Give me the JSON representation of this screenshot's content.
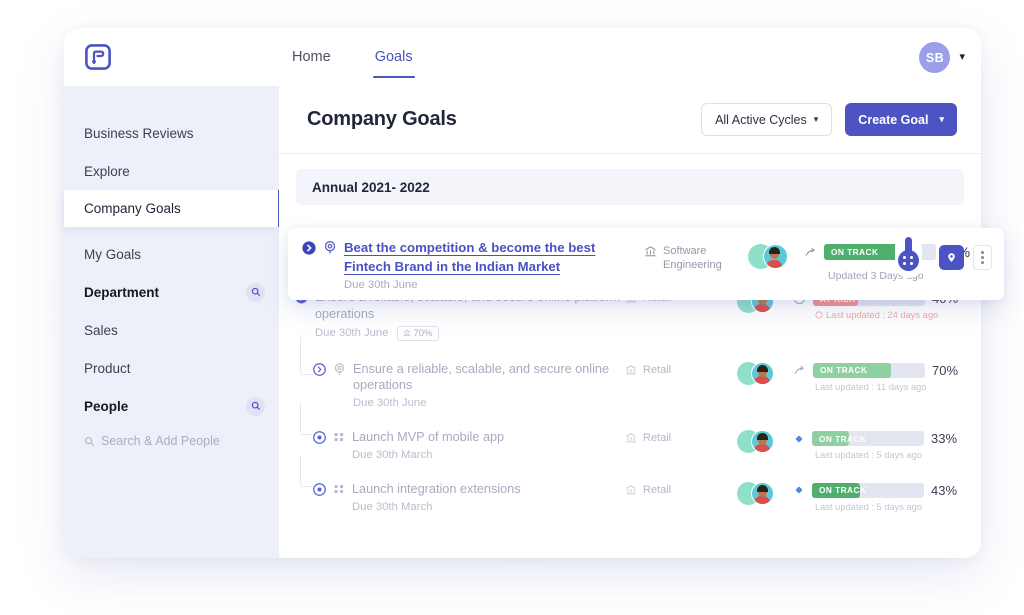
{
  "topnav": {
    "logo_icon": "logo-icon",
    "links": [
      {
        "label": "Home",
        "active": false
      },
      {
        "label": "Goals",
        "active": true
      }
    ],
    "user": {
      "initials": "SB",
      "caret_icon": "chevron-down-icon"
    }
  },
  "sidebar": {
    "items": [
      {
        "label": "Business Reviews",
        "bold": false,
        "selected": false,
        "search": false
      },
      {
        "label": "Explore",
        "bold": false,
        "selected": false,
        "search": false
      },
      {
        "label": "Company Goals",
        "bold": false,
        "selected": true,
        "search": false
      },
      {
        "label": "My Goals",
        "bold": false,
        "selected": false,
        "search": false
      },
      {
        "label": "Department",
        "bold": true,
        "selected": false,
        "search": true
      },
      {
        "label": "Sales",
        "bold": false,
        "selected": false,
        "search": false
      },
      {
        "label": "Product",
        "bold": false,
        "selected": false,
        "search": false
      },
      {
        "label": "People",
        "bold": true,
        "selected": false,
        "search": true
      }
    ],
    "people_search_placeholder": "Search & Add People",
    "search_icon": "search-icon"
  },
  "main": {
    "title": "Company Goals",
    "cycles_filter": {
      "label": "All Active Cycles",
      "caret_icon": "chevron-down-icon"
    },
    "create_goal": {
      "label": "Create Goal",
      "caret_icon": "chevron-down-icon"
    },
    "cycle_section": "Annual 2021- 2022"
  },
  "colors": {
    "brand": "#4c54c4",
    "on_track": "#4fb06d",
    "at_risk": "#f7918c",
    "track_bg": "#e3e5f0",
    "sidebar_bg": "#eef0f9"
  },
  "featured_goal": {
    "toggle_icon": "chevron-right-circle-icon",
    "kind_icon": "target-goal-icon",
    "title": "Beat the competition & become the best Fintech Brand in the Indian Market",
    "due": "Due 30th June",
    "department": "Software Engineering",
    "department_icon": "bank-icon",
    "status": "ON TRACK",
    "progress": 70,
    "progress_text": "70%",
    "updated": "Updated 3 Days ago",
    "actions": [
      {
        "icon": "location-pin-icon",
        "name": "pin-button"
      },
      {
        "icon": "more-vertical-icon",
        "name": "more-button"
      }
    ]
  },
  "goals": [
    {
      "toggle_icon": "chevron-right-circle-icon",
      "kind_icon": "none",
      "title": "Ensure a reliable, scalable, and secure online platform operations",
      "due": "Due 30th June",
      "pct_chip": "70%",
      "pct_chip_icon": "bank-icon",
      "department": "Retail",
      "department_icon": "bank-icon",
      "status": "AT RISK",
      "status_type": "risk",
      "progress": 40,
      "progress_text": "40%",
      "updated": "Last updated : 24 days ago",
      "leader_icon": "clock-alert-icon",
      "indent": 0,
      "tree": false
    },
    {
      "toggle_icon": "chevron-right-circle-icon",
      "kind_icon": "target-goal-icon",
      "title": "Ensure a reliable, scalable, and secure online operations",
      "due": "Due 30th June",
      "pct_chip": "",
      "department": "Retail",
      "department_icon": "bank-icon",
      "status": "ON TRACK",
      "status_type": "track",
      "progress": 70,
      "progress_text": "70%",
      "updated": "Last updated : 11 days ago",
      "leader_icon": "arrow-curve-icon",
      "indent": 1,
      "tree": true
    },
    {
      "toggle_icon": "dot-circle-icon",
      "kind_icon": "grid-dots-icon",
      "title": "Launch MVP of mobile app",
      "due": "Due 30th March",
      "pct_chip": "",
      "department": "Retail",
      "department_icon": "bank-icon",
      "status": "ON TRACK",
      "status_type": "track",
      "progress": 33,
      "progress_text": "33%",
      "updated": "Last updated : 5 days ago",
      "leader_icon": "diamond-icon",
      "indent": 1,
      "tree": true
    },
    {
      "toggle_icon": "dot-circle-icon",
      "kind_icon": "grid-dots-icon",
      "title": "Launch integration extensions",
      "due": "Due 30th March",
      "pct_chip": "",
      "department": "Retail",
      "department_icon": "bank-icon",
      "status": "ON TRACK",
      "status_type": "track",
      "progress": 43,
      "progress_text": "43%",
      "updated": "Last updated : 5 days ago",
      "leader_icon": "diamond-icon",
      "indent": 1,
      "tree": true
    }
  ]
}
